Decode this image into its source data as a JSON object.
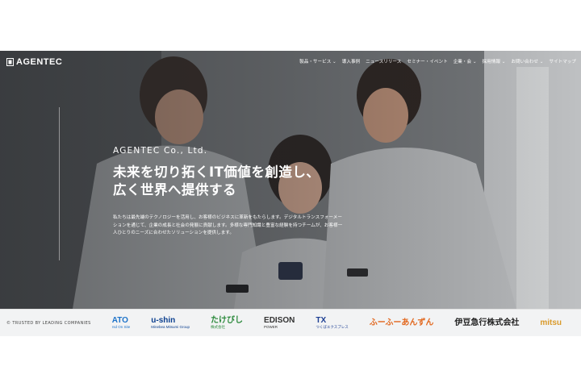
{
  "logo": {
    "text": "AGENTEC"
  },
  "nav": {
    "items": [
      "製品・サービス ⌄",
      "導入事例",
      "ニュースリリース",
      "セミナー・イベント",
      "企業・会 ⌄",
      "採用情報 ⌄",
      "お問い合わせ ⌄",
      "サイトマップ"
    ]
  },
  "hero": {
    "brand": "AGENTEC Co., Ltd.",
    "headline_line1": "未来を切り拓くIT価値を創造し、",
    "headline_line2": "広く世界へ提供する",
    "desc_line1": "私たちは最先端のテクノロジーを活用し、お客様のビジネスに革新をもたらします。デジタルトランスフォーメー",
    "desc_line2": "ションを通じて、企業の成長と社会の発展に貢献します。多様な専門知識と豊富な経験を持つチームが、お客様一",
    "desc_line3": "人ひとりのニーズに合わせたソリューションを提供します。"
  },
  "trusted": {
    "label": "TRUSTED BY LEADING COMPANIES",
    "companies": [
      {
        "main": "ATO",
        "sub": "rsd On Site",
        "color": "#1e73c9"
      },
      {
        "main": "u-shin",
        "sub": "Minebea Mitsumi Group",
        "color": "#0b3f8f"
      },
      {
        "main": "たけびし",
        "sub": "株式会社",
        "color": "#2c8a3c"
      },
      {
        "main": "EDISON",
        "sub": "POWER",
        "color": "#333333"
      },
      {
        "main": "TX",
        "sub": "つくばエクスプレス",
        "color": "#1d3f93"
      },
      {
        "main": "ふーふーあんずん",
        "sub": "",
        "color": "#e2681f"
      },
      {
        "main": "伊豆急行株式会社",
        "sub": "",
        "color": "#222222"
      },
      {
        "main": "mitsu",
        "sub": "",
        "color": "#d99a2b"
      }
    ]
  }
}
